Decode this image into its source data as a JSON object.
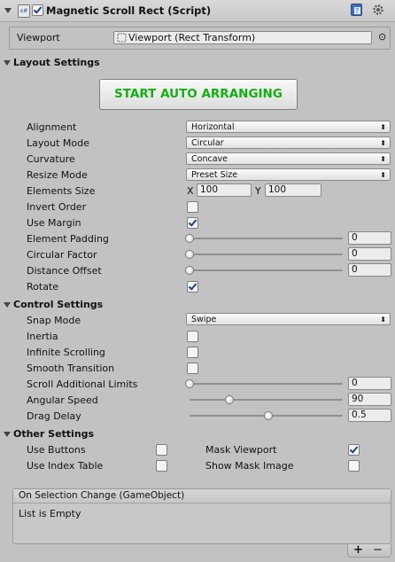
{
  "header": {
    "title": "Magnetic Scroll Rect (Script)",
    "enabled": true,
    "script_icon_text": "c#",
    "icons": [
      "book-icon",
      "gear-icon"
    ]
  },
  "viewport": {
    "label": "Viewport",
    "value": "Viewport (Rect Transform)",
    "selector_glyph": "⊙"
  },
  "layout_settings": {
    "heading": "Layout Settings",
    "start_button": "START AUTO ARRANGING",
    "alignment": {
      "label": "Alignment",
      "value": "Horizontal"
    },
    "layout_mode": {
      "label": "Layout Mode",
      "value": "Circular"
    },
    "curvature": {
      "label": "Curvature",
      "value": "Concave"
    },
    "resize_mode": {
      "label": "Resize Mode",
      "value": "Preset Size"
    },
    "elements_size": {
      "label": "Elements Size",
      "x_label": "X",
      "x_value": "100",
      "y_label": "Y",
      "y_value": "100"
    },
    "invert_order": {
      "label": "Invert Order",
      "checked": false
    },
    "use_margin": {
      "label": "Use Margin",
      "checked": true
    },
    "element_padding": {
      "label": "Element Padding",
      "value": "0",
      "fraction": 0.0
    },
    "circular_factor": {
      "label": "Circular Factor",
      "value": "0",
      "fraction": 0.0
    },
    "distance_offset": {
      "label": "Distance Offset",
      "value": "0",
      "fraction": 0.0
    },
    "rotate": {
      "label": "Rotate",
      "checked": true
    }
  },
  "control_settings": {
    "heading": "Control Settings",
    "snap_mode": {
      "label": "Snap Mode",
      "value": "Swipe"
    },
    "inertia": {
      "label": "Inertia",
      "checked": false
    },
    "infinite_scrolling": {
      "label": "Infinite Scrolling",
      "checked": false
    },
    "smooth_transition": {
      "label": "Smooth Transition",
      "checked": false
    },
    "scroll_additional_limits": {
      "label": "Scroll Additional Limits",
      "value": "0",
      "fraction": 0.0
    },
    "angular_speed": {
      "label": "Angular Speed",
      "value": "90",
      "fraction": 0.25
    },
    "drag_delay": {
      "label": "Drag Delay",
      "value": "0.5",
      "fraction": 0.5
    }
  },
  "other_settings": {
    "heading": "Other Settings",
    "use_buttons": {
      "label": "Use Buttons",
      "checked": false
    },
    "use_index_table": {
      "label": "Use Index Table",
      "checked": false
    },
    "mask_viewport": {
      "label": "Mask Viewport",
      "checked": true
    },
    "show_mask_image": {
      "label": "Show Mask Image",
      "checked": false
    }
  },
  "event": {
    "title": "On Selection Change (GameObject)",
    "body": "List is Empty",
    "add_label": "+",
    "remove_label": "−"
  },
  "colors": {
    "panel_bg": "#c2c2c2",
    "button_text": "#12b012",
    "checkmark": "#1d3f8a"
  }
}
